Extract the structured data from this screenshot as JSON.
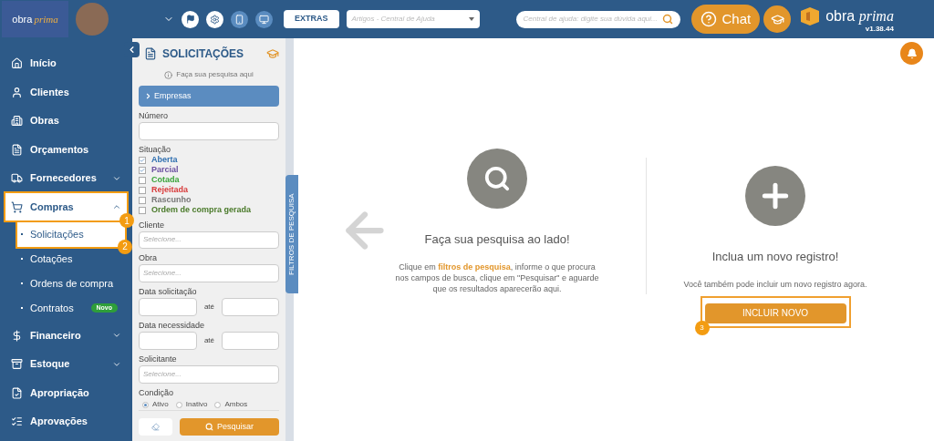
{
  "header": {
    "logo": {
      "word1": "obra",
      "word2": "prima"
    },
    "extras_button": "EXTRAS",
    "articles_select": {
      "placeholder": "Artigos - Central de Ajuda"
    },
    "help_search": {
      "placeholder": "Central de ajuda: digite sua dúvida aqui..."
    },
    "chat_button": "Chat",
    "brand": {
      "word1": "obra",
      "word2": "prima"
    },
    "version": "v1.38.44"
  },
  "sidebar": {
    "items": [
      {
        "kind": "item",
        "label": "Início",
        "highlight": false
      },
      {
        "kind": "item",
        "label": "Clientes",
        "highlight": false
      },
      {
        "kind": "item",
        "label": "Obras",
        "highlight": false
      },
      {
        "kind": "item",
        "label": "Orçamentos",
        "highlight": false
      },
      {
        "kind": "item",
        "label": "Fornecedores",
        "highlight": false,
        "expanded": false
      },
      {
        "kind": "item",
        "label": "Compras",
        "highlight": true,
        "step": "1",
        "expanded": true
      },
      {
        "kind": "subitem",
        "label": "Solicitações",
        "highlight": true,
        "step": "2"
      },
      {
        "kind": "subitem",
        "label": "Cotações",
        "highlight": false
      },
      {
        "kind": "subitem",
        "label": "Ordens de compra",
        "highlight": false
      },
      {
        "kind": "subitem",
        "label": "Contratos",
        "highlight": false,
        "badge": "Novo"
      },
      {
        "kind": "item",
        "label": "Financeiro",
        "highlight": false,
        "expanded": false
      },
      {
        "kind": "item",
        "label": "Estoque",
        "highlight": false,
        "expanded": false
      },
      {
        "kind": "item",
        "label": "Apropriação",
        "highlight": false
      },
      {
        "kind": "item",
        "label": "Aprovações",
        "highlight": false
      }
    ]
  },
  "filters": {
    "title": "SOLICITAÇÕES",
    "hint": "Faça sua pesquisa aqui",
    "companies": "Empresas",
    "numero_label": "Número",
    "situacao_label": "Situação",
    "statuses": [
      {
        "label": "Aberta",
        "checked": true,
        "color": "#2f6fb0"
      },
      {
        "label": "Parcial",
        "checked": true,
        "color": "#6a4fa0"
      },
      {
        "label": "Cotada",
        "checked": false,
        "color": "#3aa33a"
      },
      {
        "label": "Rejeitada",
        "checked": false,
        "color": "#d83a3a"
      },
      {
        "label": "Rascunho",
        "checked": false,
        "color": "#777777"
      },
      {
        "label": "Ordem de compra gerada",
        "checked": false,
        "color": "#4a7a2a"
      }
    ],
    "cliente": {
      "label": "Cliente",
      "placeholder": "Selecione..."
    },
    "obra": {
      "label": "Obra",
      "placeholder": "Selecione..."
    },
    "data_solicitacao": {
      "label": "Data solicitação",
      "until": "até"
    },
    "data_necessidade": {
      "label": "Data necessidade",
      "until": "até"
    },
    "solicitante": {
      "label": "Solicitante",
      "placeholder": "Selecione..."
    },
    "condicao": {
      "label": "Condição",
      "options": [
        {
          "label": "Ativo",
          "selected": true
        },
        {
          "label": "Inativo",
          "selected": false
        },
        {
          "label": "Ambos",
          "selected": false
        }
      ]
    },
    "search_button": "Pesquisar",
    "side_tab": "FILTROS DE PESQUISA"
  },
  "main": {
    "search_panel": {
      "title": "Faça sua pesquisa ao lado!",
      "text": "Clique em **filtros de pesquisa**, informe o que procura nos campos de busca, clique em \"Pesquisar\" e aguarde que os resultados aparecerão aqui."
    },
    "new_panel": {
      "title": "Inclua um novo registro!",
      "text": "Você também pode incluir um novo registro agora.",
      "button": "INCLUIR NOVO",
      "step": "3"
    }
  }
}
